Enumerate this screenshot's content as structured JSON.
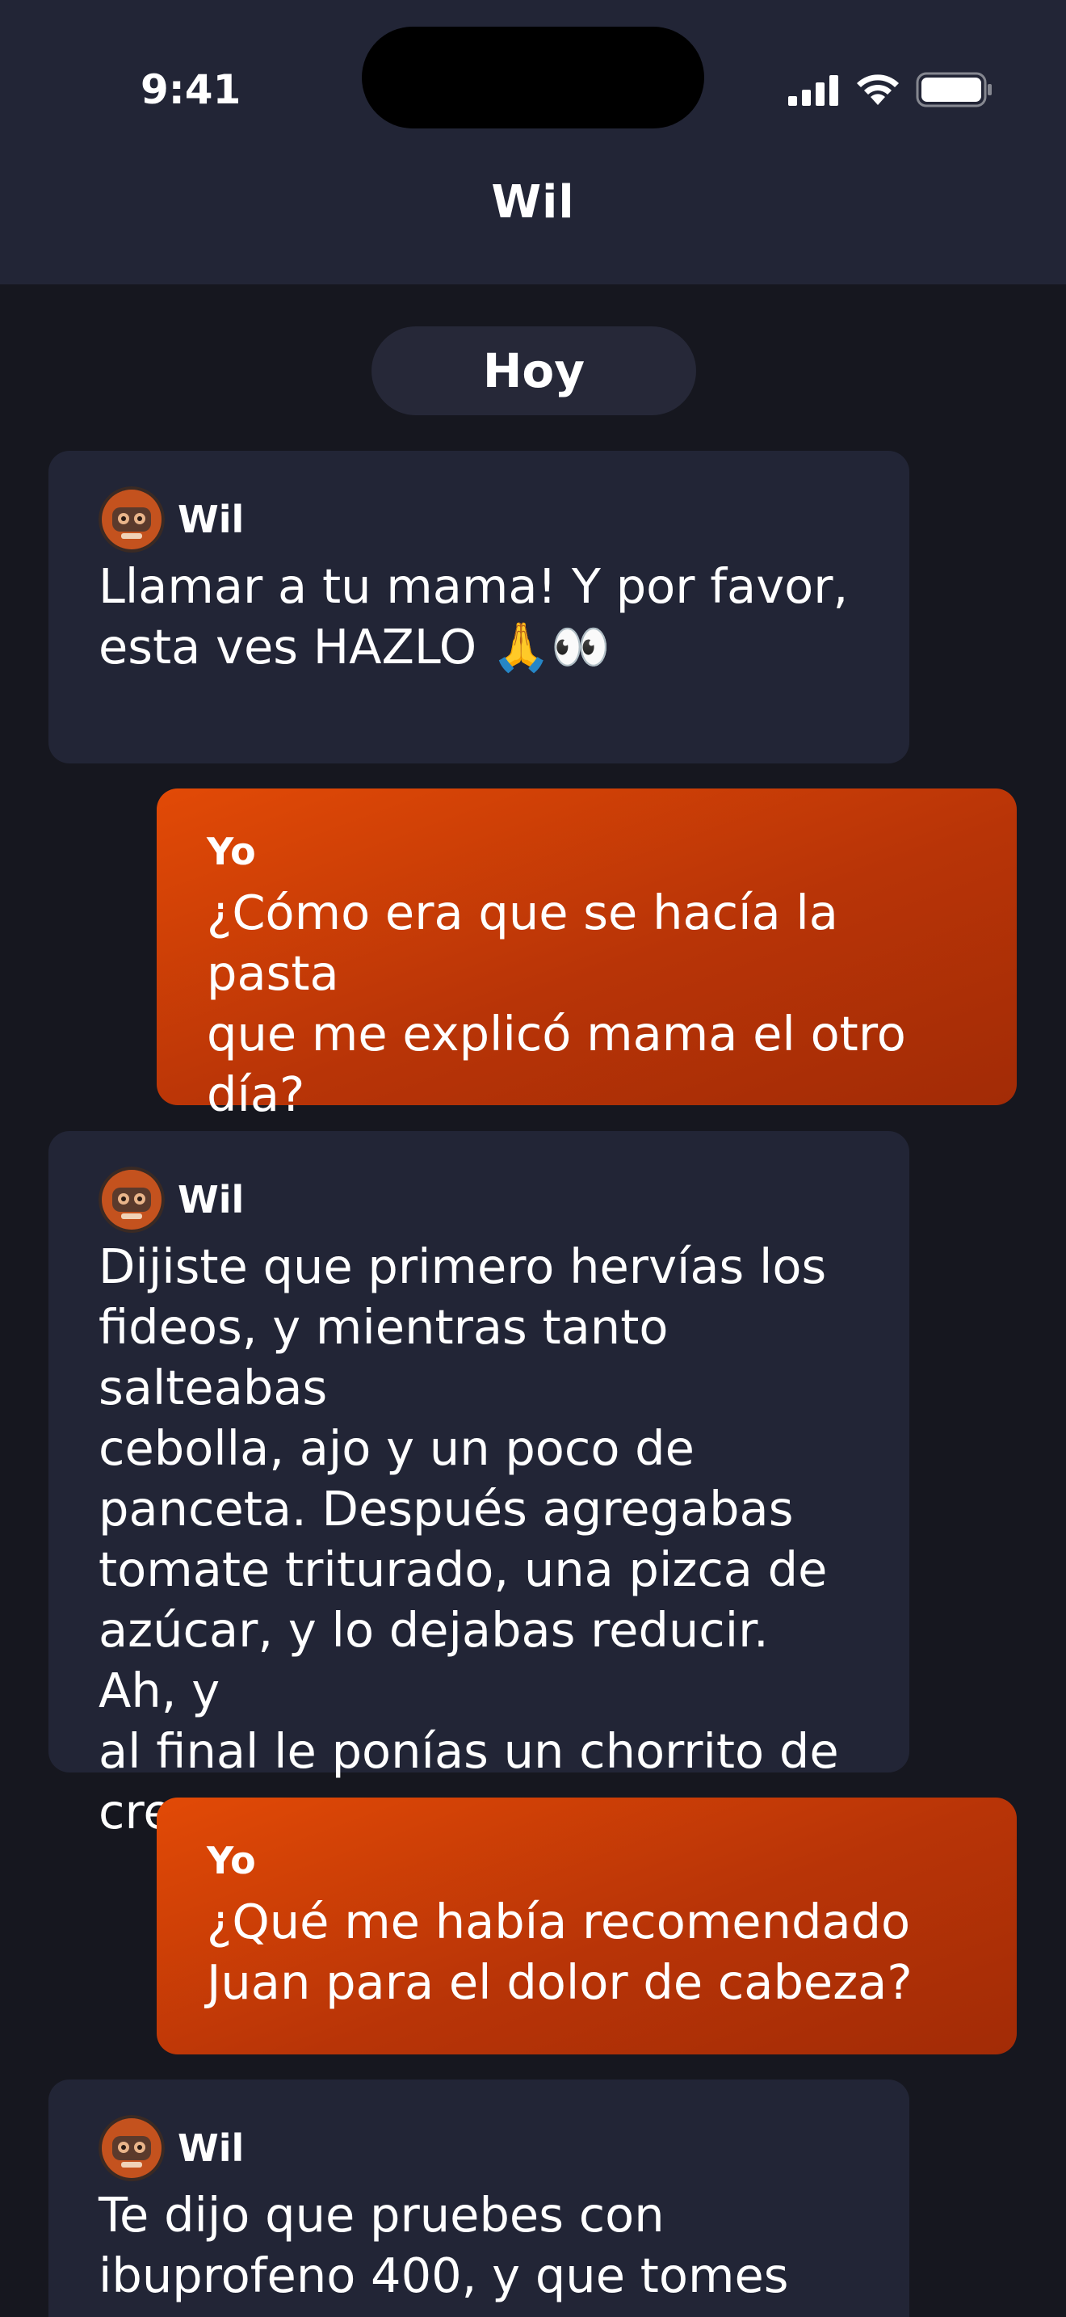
{
  "status_bar": {
    "time": "9:41"
  },
  "header": {
    "title": "Wil"
  },
  "chat": {
    "date_label": "Hoy",
    "messages": [
      {
        "from": "bot",
        "sender": "Wil",
        "text": "Llamar a tu mama! Y por favor,\nesta ves HAZLO 🙏👀"
      },
      {
        "from": "me",
        "sender": "Yo",
        "text": "¿Cómo era que se hacía la pasta\nque me explicó mama el otro\ndía?"
      },
      {
        "from": "bot",
        "sender": "Wil",
        "text": "Dijiste que primero hervías los\nfideos, y mientras tanto salteabas\ncebolla, ajo y un poco de\npanceta. Después agregabas\ntomate triturado, una pizca de\nazúcar, y lo dejabas reducir. Ah, y\nal final le ponías un chorrito de\ncrema."
      },
      {
        "from": "me",
        "sender": "Yo",
        "text": "¿Qué me había recomendado\nJuan para el dolor de cabeza?"
      },
      {
        "from": "bot",
        "sender": "Wil",
        "text": "Te dijo que pruebes con\nibuprofeno 400, y que tomes"
      }
    ]
  },
  "icons": {
    "cellular": "cellular-signal-icon",
    "wifi": "wifi-icon",
    "battery": "battery-icon",
    "avatar": "robot-avatar-icon"
  },
  "colors": {
    "background": "#16171f",
    "header": "#222536",
    "bot_bubble": "#222536",
    "user_bubble_start": "#e24a06",
    "user_bubble_end": "#a22b06"
  }
}
